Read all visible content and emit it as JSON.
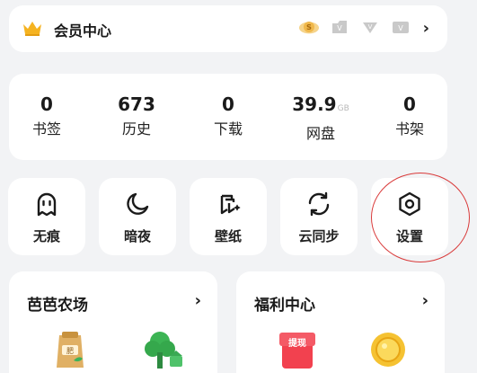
{
  "member": {
    "title": "会员中心",
    "badges": [
      "S",
      "V",
      "V",
      "V"
    ],
    "chevron": "›"
  },
  "stats": [
    {
      "value": "0",
      "unit": "",
      "label": "书签"
    },
    {
      "value": "673",
      "unit": "",
      "label": "历史"
    },
    {
      "value": "0",
      "unit": "",
      "label": "下载"
    },
    {
      "value": "39.9",
      "unit": "GB",
      "label": "网盘"
    },
    {
      "value": "0",
      "unit": "",
      "label": "书架"
    }
  ],
  "tools": [
    {
      "label": "无痕",
      "icon": "ghost-icon"
    },
    {
      "label": "暗夜",
      "icon": "moon-icon"
    },
    {
      "label": "壁纸",
      "icon": "wallpaper-icon"
    },
    {
      "label": "云同步",
      "icon": "sync-icon"
    },
    {
      "label": "设置",
      "icon": "settings-hexagon-icon"
    }
  ],
  "cards": {
    "farm": {
      "title": "芭芭农场",
      "chevron": "›"
    },
    "welfare": {
      "title": "福利中心",
      "chevron": "›",
      "withdraw_label": "提现"
    }
  },
  "colors": {
    "background": "#f2f3f5",
    "card": "#ffffff",
    "highlight_circle": "#d93a3a",
    "crown": "#f5b321"
  }
}
